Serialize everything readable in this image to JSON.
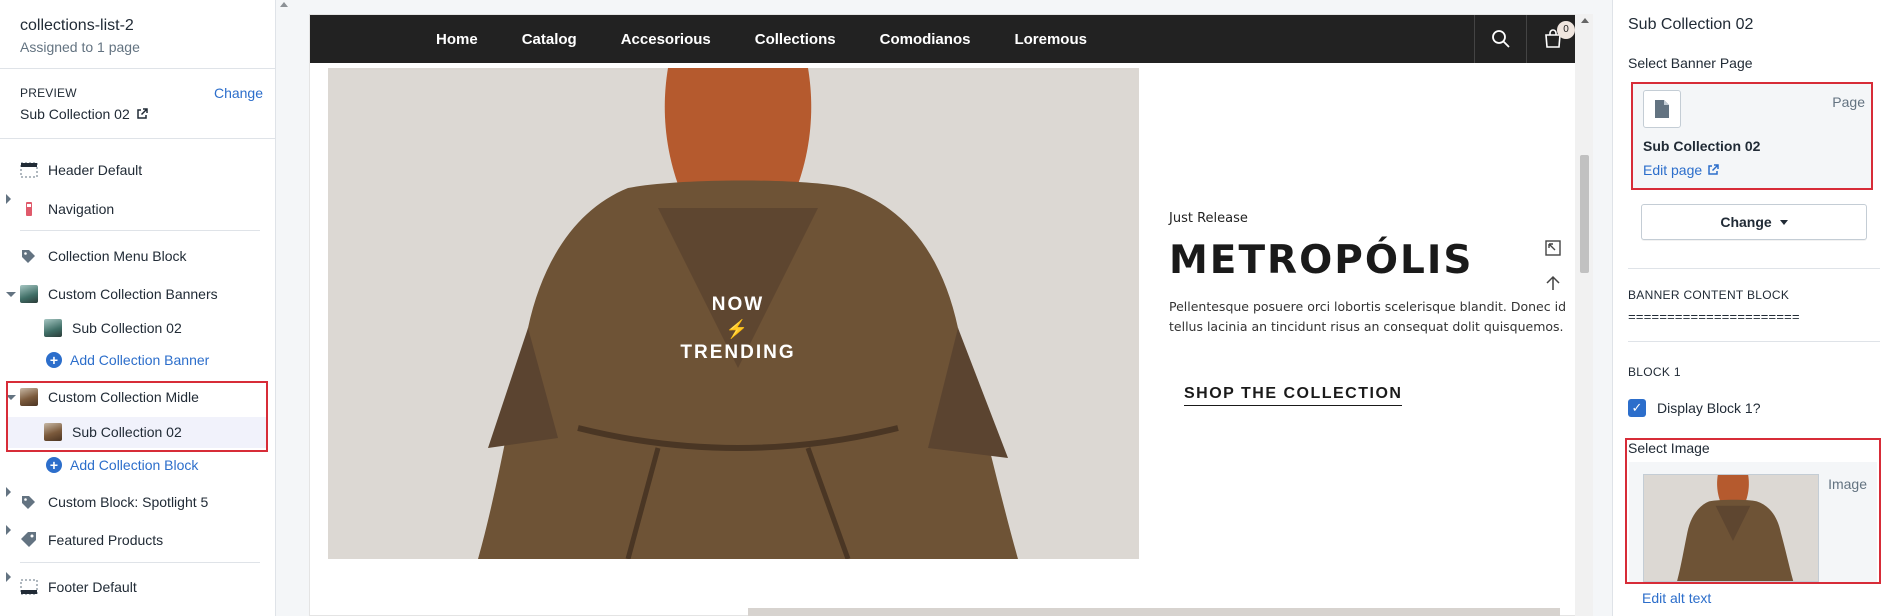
{
  "template": {
    "title": "collections-list-2",
    "subtitle": "Assigned to 1 page",
    "preview_label": "PREVIEW",
    "preview_change": "Change",
    "preview_value": "Sub Collection 02"
  },
  "sidebar": {
    "items": [
      {
        "label": "Header Default"
      },
      {
        "label": "Navigation"
      },
      {
        "label": "Collection Menu Block"
      },
      {
        "label": "Custom Collection Banners"
      },
      {
        "label": "Sub Collection 02"
      },
      {
        "label": "Add Collection Banner"
      },
      {
        "label": "Custom Collection Midle"
      },
      {
        "label": "Sub Collection 02"
      },
      {
        "label": "Add Collection Block"
      },
      {
        "label": "Custom Block: Spotlight 5"
      },
      {
        "label": "Featured Products"
      },
      {
        "label": "Footer Default"
      }
    ]
  },
  "storefront": {
    "menu": [
      "Home",
      "Catalog",
      "Accesorious",
      "Collections",
      "Comodianos",
      "Loremous"
    ],
    "cart_count": "0",
    "hero_text": [
      "NOW",
      "TRENDING"
    ],
    "banner": {
      "eyebrow": "Just Release",
      "heading": "METROPÓLIS",
      "description": "Pellentesque posuere orci lobortis scelerisque blandit. Donec id tellus lacinia an tincidunt risus an consequat dolit quisquemos.",
      "cta": "SHOP THE COLLECTION"
    }
  },
  "settings": {
    "title": "Sub Collection 02",
    "select_banner_label": "Select Banner Page",
    "page_tag": "Page",
    "page_name": "Sub Collection 02",
    "edit_page": "Edit page",
    "change_button": "Change",
    "banner_content_heading": "BANNER CONTENT BLOCK",
    "separator": "======================",
    "block_heading": "BLOCK 1",
    "display_block_label": "Display Block 1?",
    "display_block_checked": true,
    "select_image_label": "Select Image",
    "image_tag": "Image",
    "edit_alt_text": "Edit alt text"
  },
  "colors": {
    "accent": "#2c6ecb",
    "highlight_border": "#d72c38",
    "nav_bg": "#222222"
  }
}
